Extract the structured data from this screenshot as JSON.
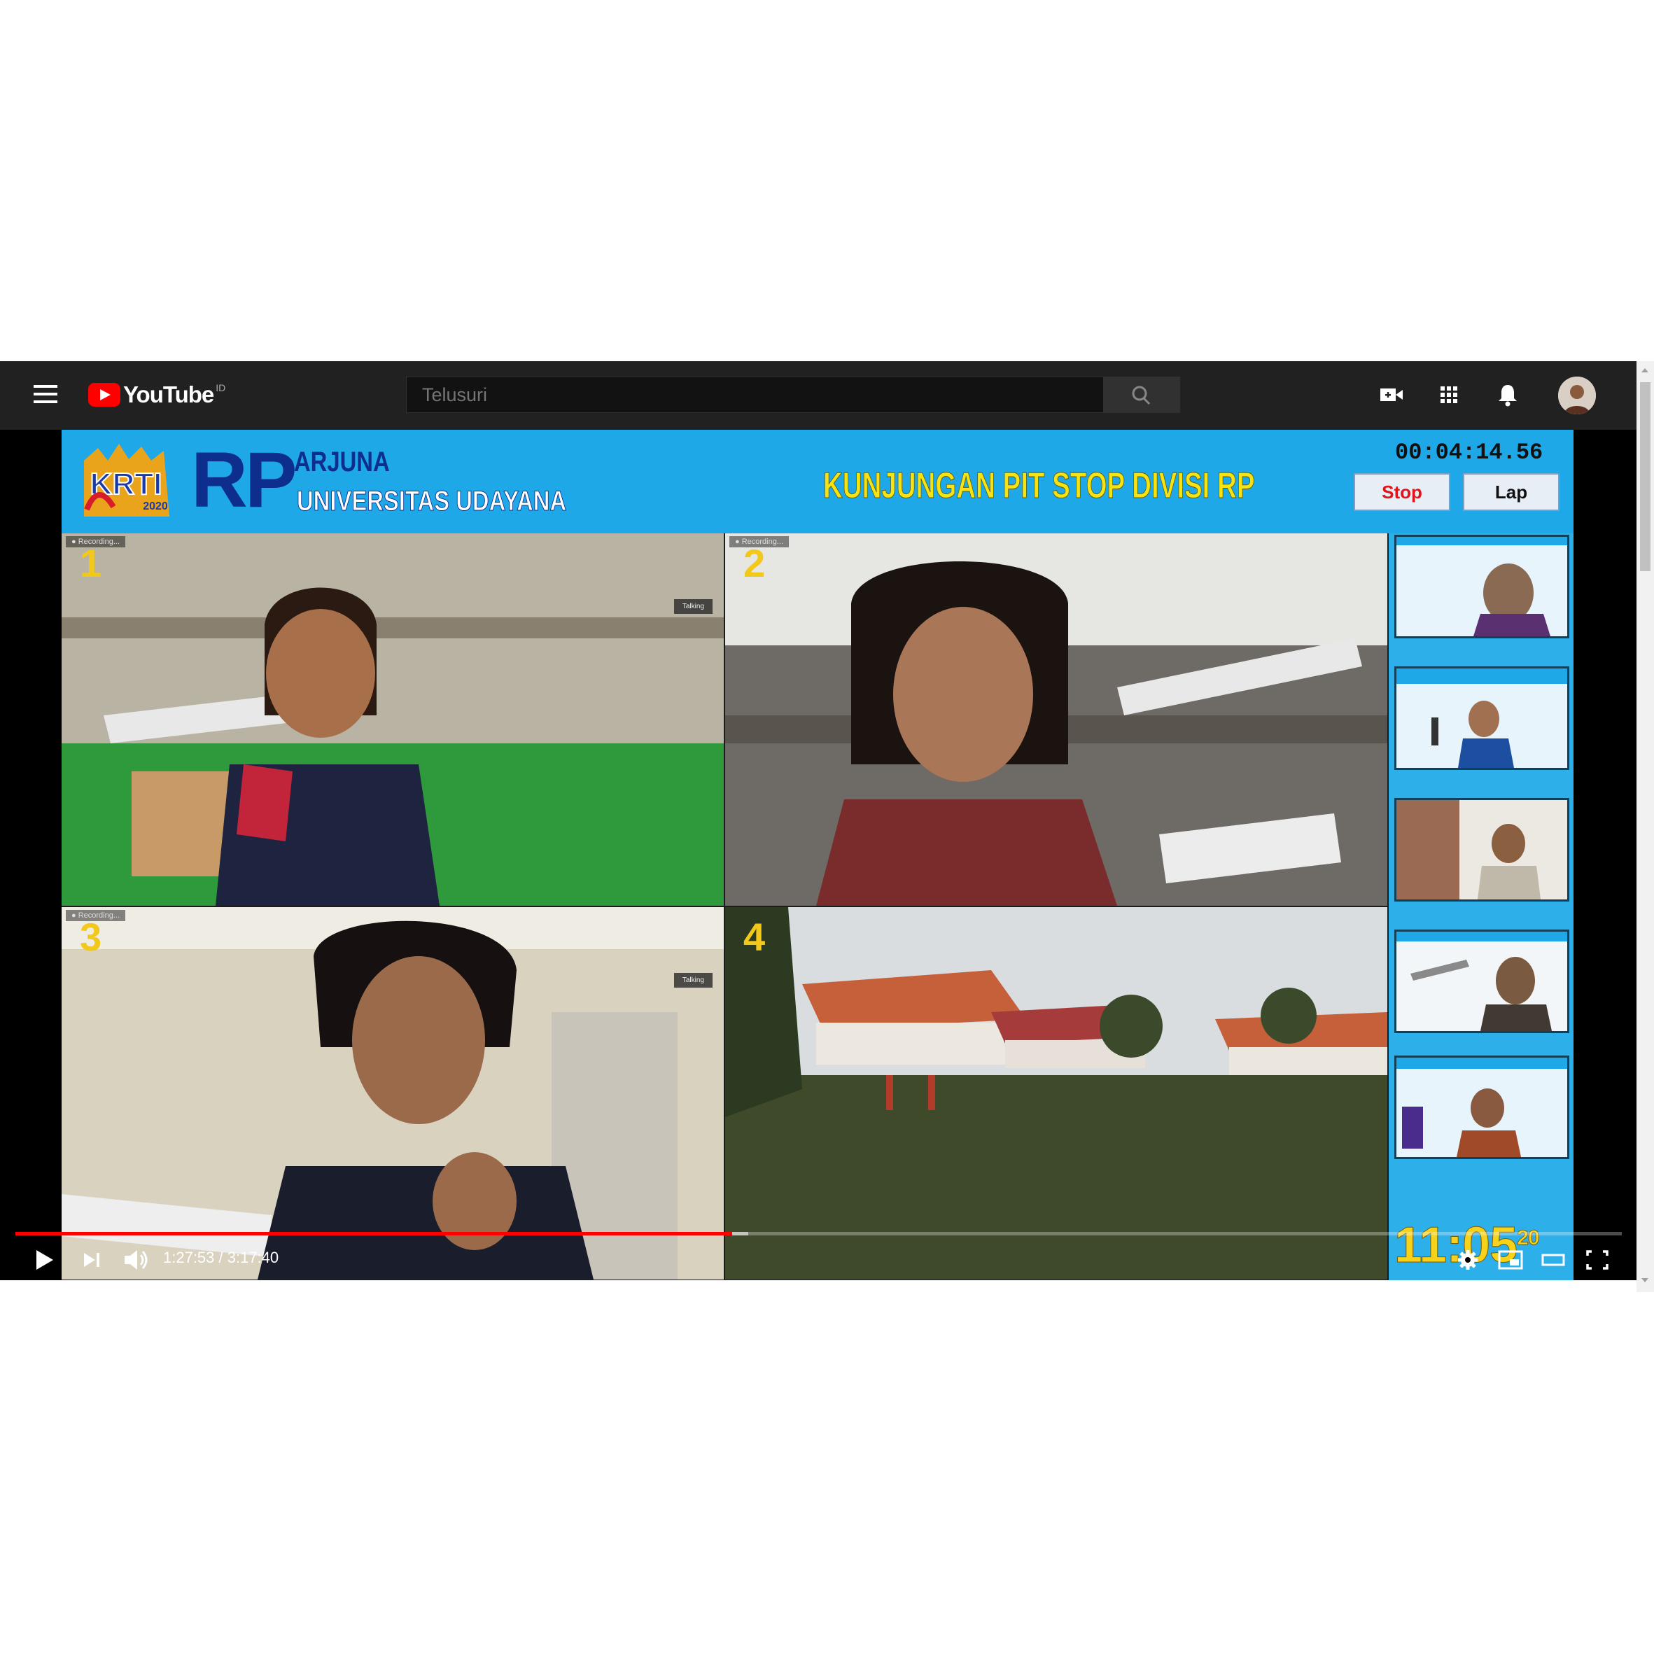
{
  "youtube": {
    "logo_text": "YouTube",
    "country_code": "ID",
    "search_placeholder": "Telusuri"
  },
  "header_icons": [
    "hamburger-menu-icon",
    "create-video-icon",
    "apps-grid-icon",
    "notifications-bell-icon",
    "account-avatar"
  ],
  "video": {
    "banner": {
      "division": "RP",
      "team": "ARJUNA",
      "university": "UNIVERSITAS UDAYANA",
      "title": "KUNJUNGAN PIT STOP DIVISI RP",
      "logo_text": "KRTI",
      "logo_year": "2020",
      "stopwatch": "00:04:14.56",
      "stop_label": "Stop",
      "lap_label": "Lap"
    },
    "tiles": [
      {
        "number": "1"
      },
      {
        "number": "2"
      },
      {
        "number": "3"
      },
      {
        "number": "4"
      }
    ],
    "clock": {
      "time": "11:05",
      "seconds": "20"
    }
  },
  "player": {
    "current_time": "1:27:53",
    "separator": " / ",
    "duration": "3:17:40",
    "progress_fraction": 0.446,
    "buffered_fraction": 0.456
  },
  "colors": {
    "youtube_red": "#ff0000",
    "header_bg": "#212121",
    "banner_blue": "#1ea8e8",
    "title_yellow": "#f4e415",
    "team_navy": "#0d2e8c"
  }
}
